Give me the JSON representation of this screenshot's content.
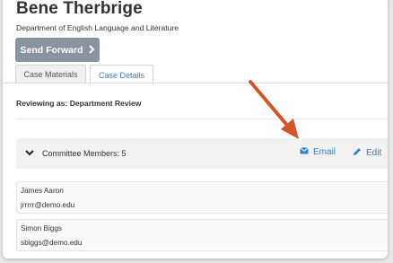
{
  "header": {
    "name": "Bene Therbrige",
    "department": "Department of English Language and Literature",
    "send_forward_label": "Send Forward"
  },
  "tabs": [
    {
      "label": "Case Materials",
      "active": false
    },
    {
      "label": "Case Details",
      "active": true
    }
  ],
  "reviewing_as": "Reviewing as: Department Review",
  "committee": {
    "label": "Committee Members: 5",
    "email_label": "Email",
    "edit_label": "Edit"
  },
  "members": [
    {
      "name": "James Aaron",
      "email": "jrrrrr@demo.edu"
    },
    {
      "name": "Simon Biggs",
      "email": "sbiggs@demo.edu"
    }
  ],
  "colors": {
    "accent": "#3a7fc1",
    "button_gray": "#8a93a0",
    "annotation_arrow": "#d4552a"
  },
  "icons": {
    "send_chevron": "chevron-right-icon",
    "expand_chevron": "chevron-down-icon",
    "email": "envelope-icon",
    "edit": "pencil-icon"
  }
}
